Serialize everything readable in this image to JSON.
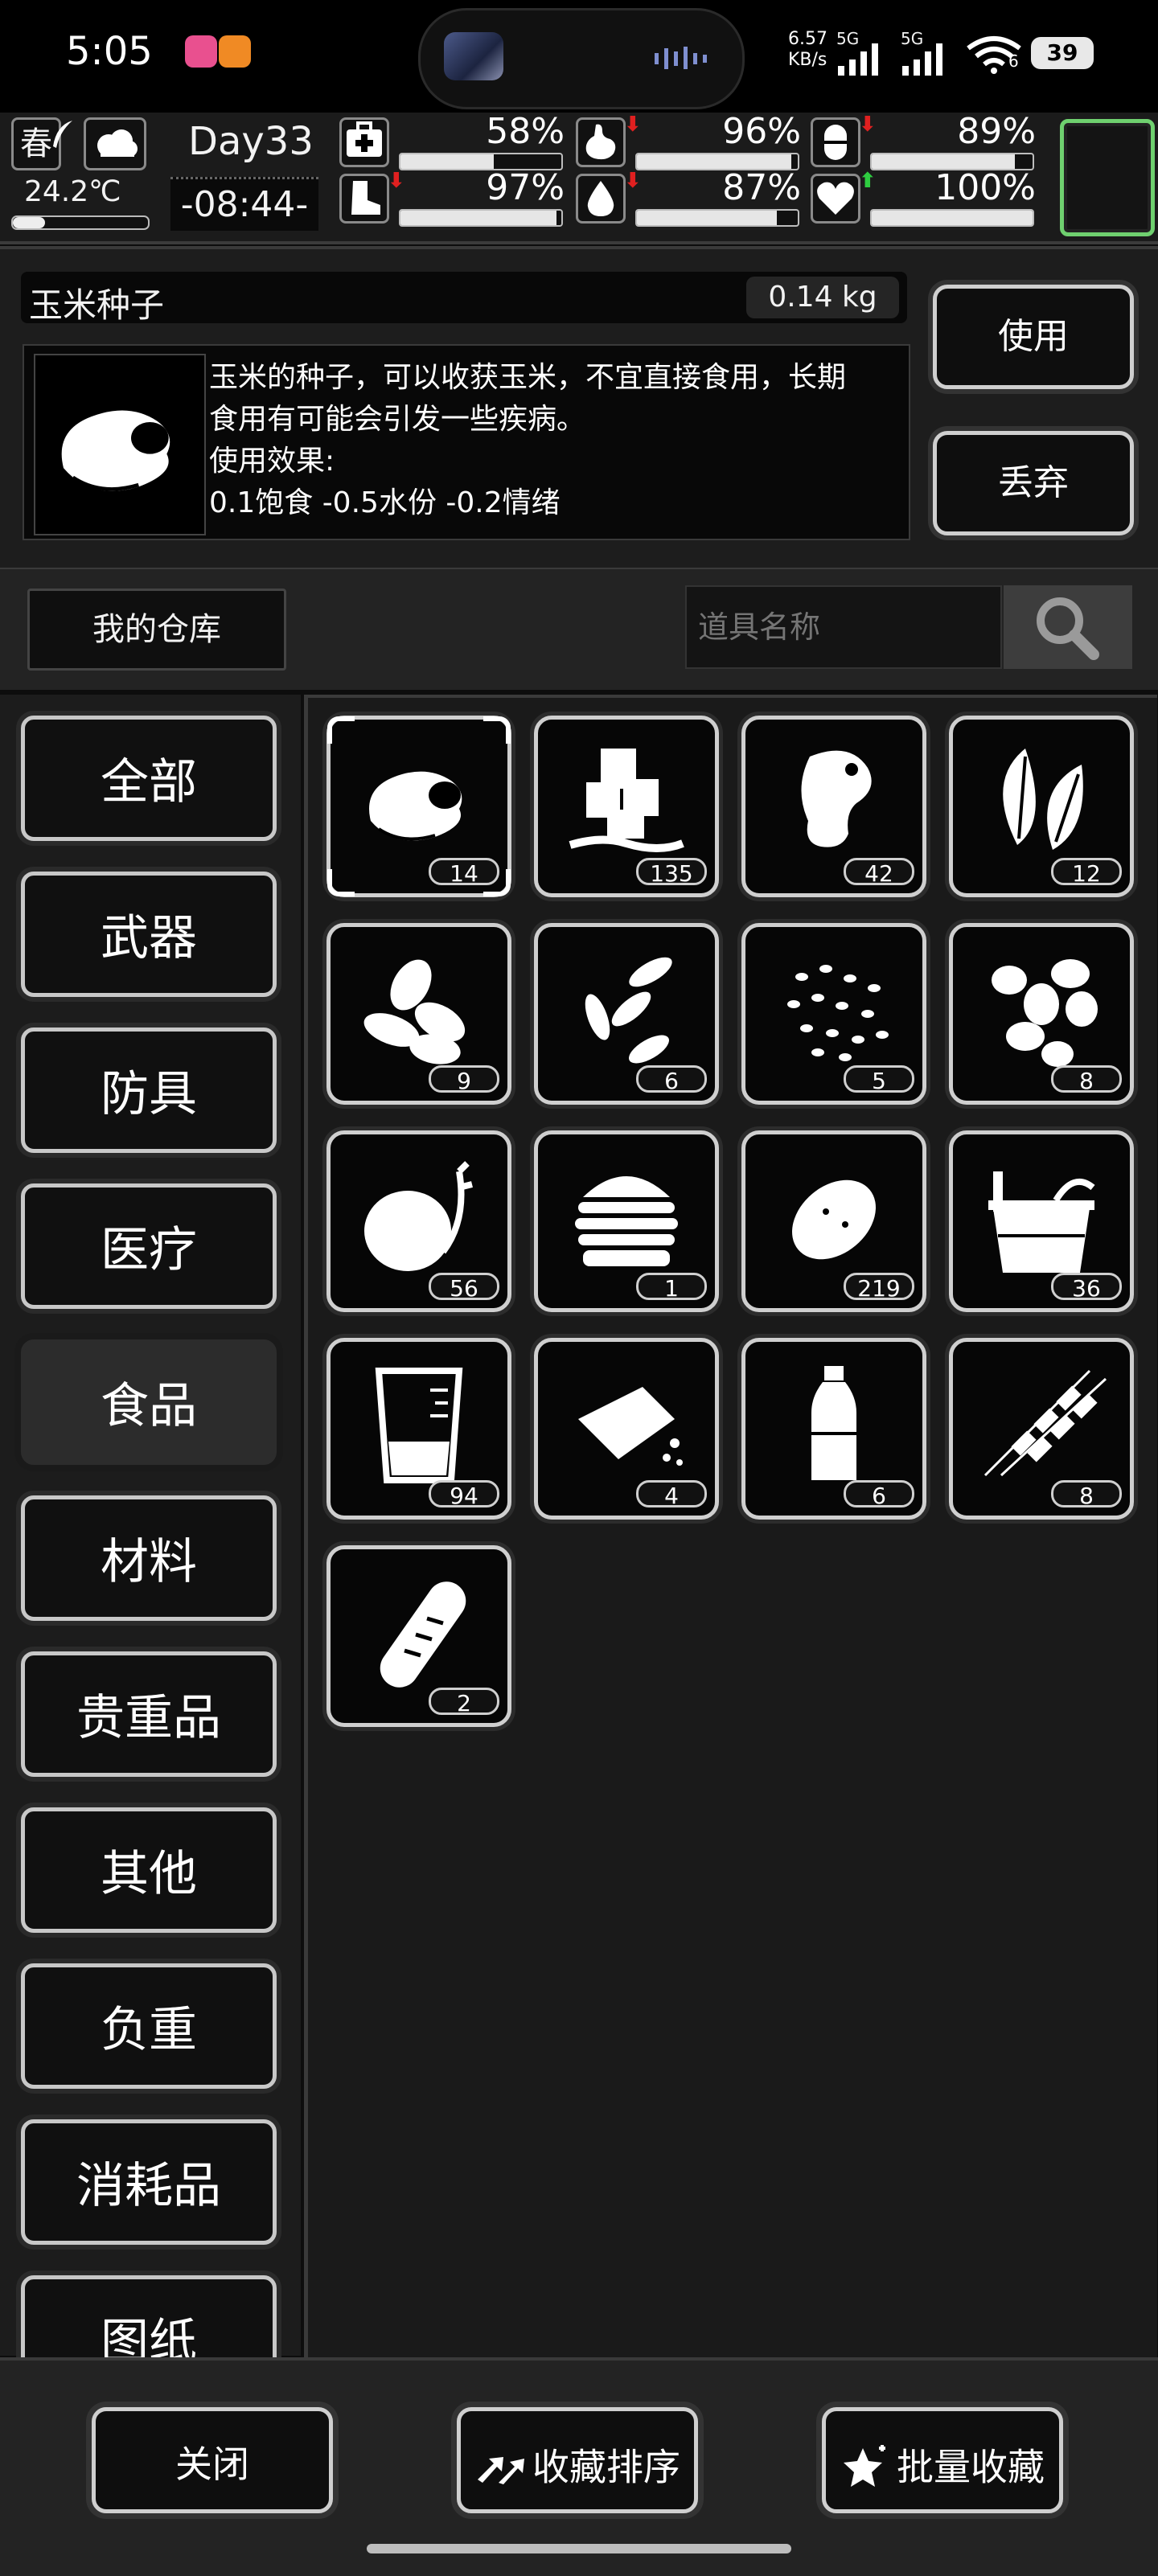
{
  "status_bar": {
    "time": "5:05",
    "net_speed_value": "6.57",
    "net_speed_unit": "KB/s",
    "signal1": "5G",
    "signal2": "5G",
    "wifi_label": "6",
    "battery": "39"
  },
  "hud": {
    "season": "春",
    "temperature": "24.2℃",
    "day": "Day33",
    "clock": "-08:44-",
    "stats": [
      {
        "icon": "medkit-icon",
        "value": "58%",
        "level": 0.58,
        "trend": ""
      },
      {
        "icon": "stomach-icon",
        "value": "96%",
        "level": 0.96,
        "trend": "down"
      },
      {
        "icon": "pill-icon",
        "value": "89%",
        "level": 0.89,
        "trend": "down"
      },
      {
        "icon": "boot-icon",
        "value": "97%",
        "level": 0.97,
        "trend": "down"
      },
      {
        "icon": "water-drop-icon",
        "value": "87%",
        "level": 0.87,
        "trend": "down"
      },
      {
        "icon": "heart-icon",
        "value": "100%",
        "level": 1.0,
        "trend": "up"
      }
    ],
    "trend_colors": {
      "down": "#e02020",
      "up": "#2ecc40"
    },
    "slot_border_color": "#6fd06f"
  },
  "detail": {
    "item_name": "玉米种子",
    "weight": "0.14 kg",
    "description_lines": [
      "玉米的种子，可以收获玉米，不宜直接食用，长期",
      "食用有可能会引发一些疾病。",
      "使用效果:",
      "0.1饱食 -0.5水份 -0.2情绪"
    ],
    "use_label": "使用",
    "discard_label": "丢弃"
  },
  "warehouse": {
    "tab_label": "我的仓库",
    "search_placeholder": "道具名称"
  },
  "categories": [
    "全部",
    "武器",
    "防具",
    "医疗",
    "食品",
    "材料",
    "贵重品",
    "其他",
    "负重",
    "消耗品",
    "图纸"
  ],
  "selected_category": "食品",
  "items": [
    {
      "icon": "corn-seed-icon",
      "count": "14",
      "selected": true
    },
    {
      "icon": "ice-cubes-icon",
      "count": "135"
    },
    {
      "icon": "raw-meat-icon",
      "count": "42"
    },
    {
      "icon": "leaves-icon",
      "count": "12"
    },
    {
      "icon": "almonds-icon",
      "count": "9"
    },
    {
      "icon": "seeds-icon",
      "count": "6"
    },
    {
      "icon": "grain-seeds-icon",
      "count": "5"
    },
    {
      "icon": "beans-icon",
      "count": "8"
    },
    {
      "icon": "sprouting-potato-icon",
      "count": "56"
    },
    {
      "icon": "burger-icon",
      "count": "1"
    },
    {
      "icon": "potato-icon",
      "count": "219"
    },
    {
      "icon": "bucket-icon",
      "count": "36"
    },
    {
      "icon": "beaker-icon",
      "count": "94"
    },
    {
      "icon": "bread-piece-icon",
      "count": "4"
    },
    {
      "icon": "water-bottle-icon",
      "count": "6"
    },
    {
      "icon": "skewers-icon",
      "count": "8"
    },
    {
      "icon": "baguette-icon",
      "count": "2"
    }
  ],
  "footer": {
    "close_label": "关闭",
    "sort_label": "收藏排序",
    "batch_label": "批量收藏"
  }
}
